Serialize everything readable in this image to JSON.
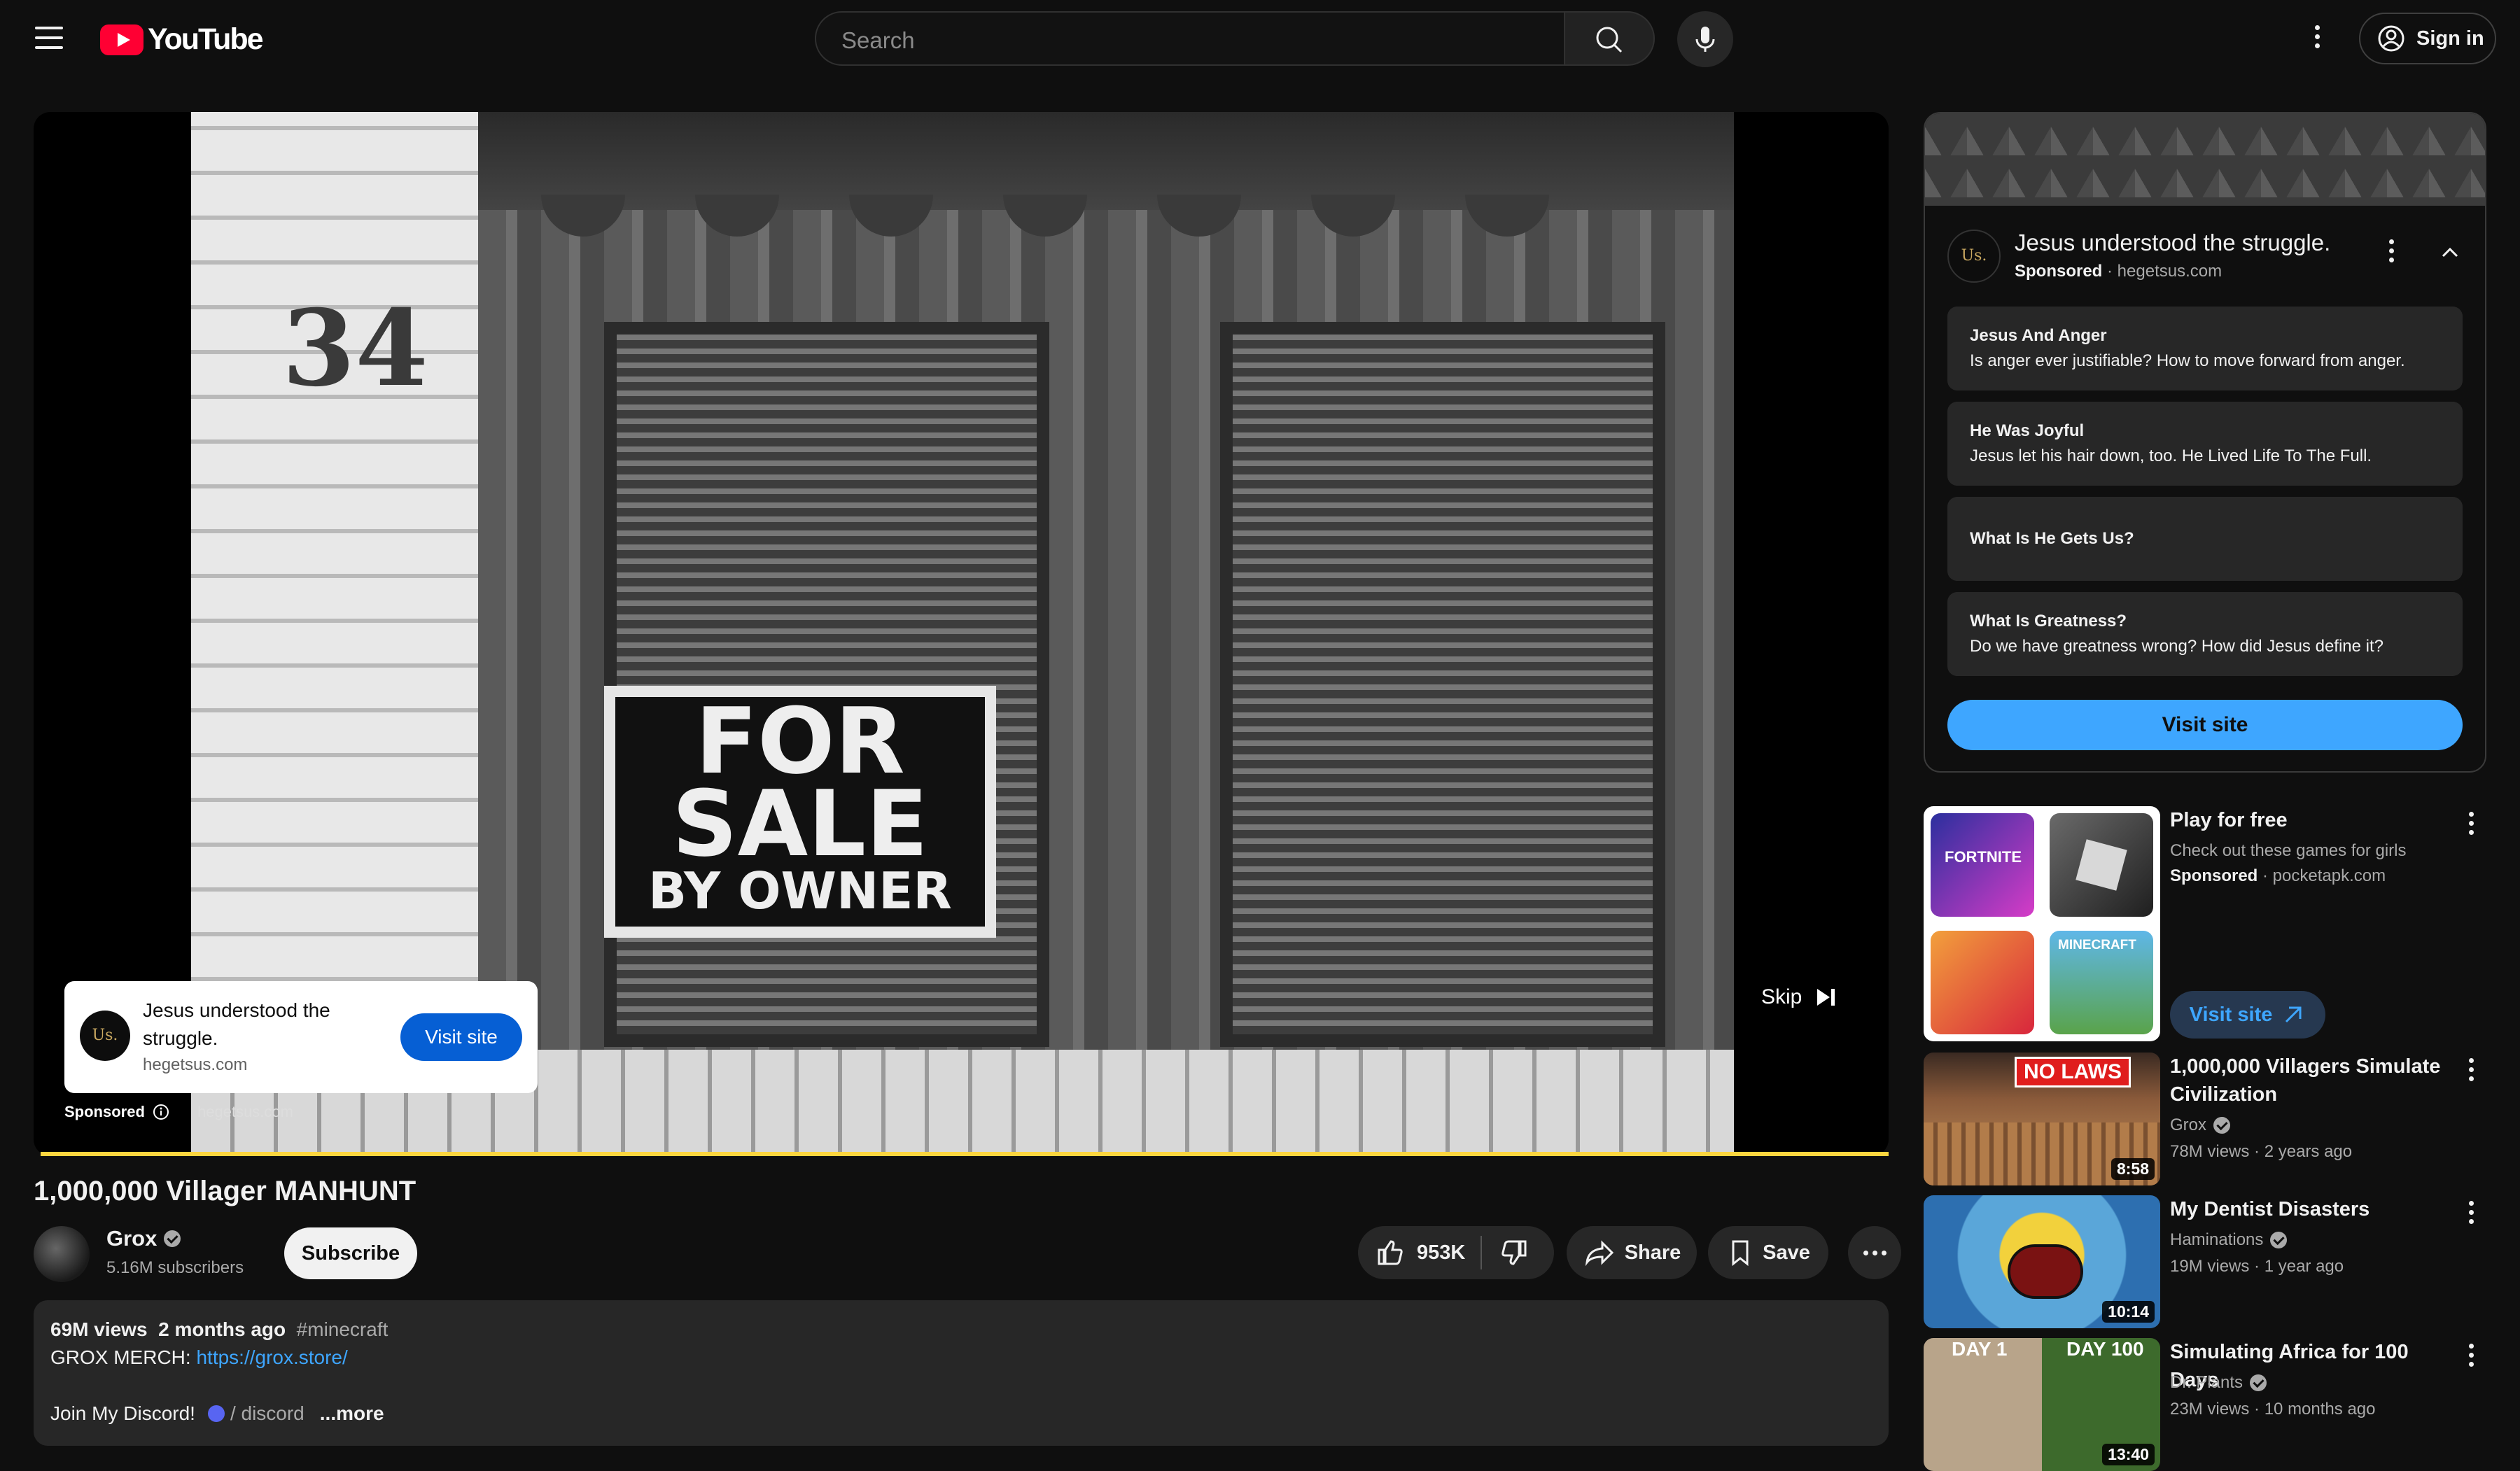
{
  "header": {
    "logo_text": "YouTube",
    "search_placeholder": "Search",
    "sign_in_label": "Sign in"
  },
  "player": {
    "ad_card": {
      "avatar_text": "Us.",
      "title": "Jesus understood the struggle.",
      "domain": "hegetsus.com",
      "visit_label": "Visit site"
    },
    "sponsored_label": "Sponsored",
    "sponsored_domain": "hegetsus.com",
    "skip_label": "Skip",
    "sign_house_number": "34",
    "sign_line1": "FOR",
    "sign_line2": "SALE",
    "sign_line3": "BY OWNER"
  },
  "video": {
    "title": "1,000,000 Villager MANHUNT",
    "channel": "Grox",
    "subscribers": "5.16M subscribers",
    "subscribe_label": "Subscribe",
    "likes": "953K",
    "share_label": "Share",
    "save_label": "Save",
    "description": {
      "views": "69M views",
      "date": "2 months ago",
      "hashtag": "#minecraft",
      "merch_prefix": "GROX MERCH: ",
      "merch_link": "https://grox.store/",
      "discord_prefix": "Join My Discord!",
      "discord_link": "/ discord",
      "more_label": "...more"
    }
  },
  "sidebar_ad": {
    "avatar_text": "Us.",
    "title": "Jesus understood the struggle.",
    "sponsored": "Sponsored",
    "domain": "hegetsus.com",
    "items": [
      {
        "title": "Jesus And Anger",
        "subtitle": "Is anger ever justifiable? How to move forward from anger."
      },
      {
        "title": "He Was Joyful",
        "subtitle": "Jesus let his hair down, too. He Lived Life To The Full."
      },
      {
        "title": "What Is He Gets Us?",
        "subtitle": ""
      },
      {
        "title": "What Is Greatness?",
        "subtitle": "Do we have greatness wrong? How did Jesus define it?"
      }
    ],
    "visit_label": "Visit site"
  },
  "promo": {
    "title": "Play for free",
    "subtitle": "Check out these games for girls",
    "sponsored": "Sponsored",
    "domain": "pocketapk.com",
    "visit_label": "Visit site",
    "tiles": [
      "FORTNITE",
      "",
      "",
      "MINECRAFT"
    ]
  },
  "related": [
    {
      "title": "1,000,000 Villagers Simulate Civilization",
      "channel": "Grox",
      "views": "78M views",
      "age": "2 years ago",
      "duration": "8:58",
      "badge": "NO LAWS"
    },
    {
      "title": "My Dentist Disasters",
      "channel": "Haminations",
      "views": "19M views",
      "age": "1 year ago",
      "duration": "10:14",
      "badge": ""
    },
    {
      "title": "Simulating Africa for 100 Days",
      "channel": "Dr. Plants",
      "views": "23M views",
      "age": "10 months ago",
      "duration": "13:40",
      "badge_left": "DAY 1",
      "badge_right": "DAY 100"
    }
  ],
  "colors": {
    "accent_red": "#ff0033",
    "link_blue": "#3ea6ff",
    "progress_yellow": "#fcd53f",
    "button_blue": "#065fd4"
  }
}
